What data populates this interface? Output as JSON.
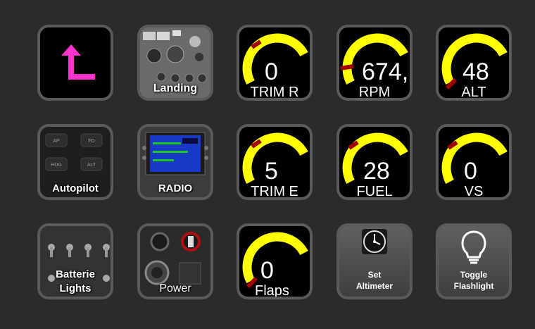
{
  "colors": {
    "background": "#2b2b2b",
    "gauge_arc": "#ffff00",
    "gauge_needle": "#a00000",
    "back_arrow": "#ff33cc"
  },
  "buttons": {
    "back": {
      "icon": "back-arrow-icon"
    },
    "landing": {
      "label": "Landing"
    },
    "autopilot": {
      "label": "Autopilot",
      "panel_labels": [
        "AP",
        "FD",
        "HDG",
        "ALT"
      ]
    },
    "radio": {
      "label": "RADIO"
    },
    "batteries": {
      "label_line1": "Batterie",
      "label_line2": "Lights"
    },
    "power": {
      "label": "Power"
    },
    "set_altimeter": {
      "label_line1": "Set",
      "label_line2": "Altimeter",
      "icon": "altimeter-icon"
    },
    "toggle_flashlight": {
      "label_line1": "Toggle",
      "label_line2": "Flashlight",
      "icon": "lightbulb-icon"
    }
  },
  "gauges": {
    "trim_r": {
      "value": "0",
      "label": "TRIM R"
    },
    "rpm": {
      "value": "674,",
      "label": "RPM"
    },
    "alt": {
      "value": "48",
      "label": "ALT"
    },
    "trim_e": {
      "value": "5",
      "label": "TRIM E"
    },
    "fuel": {
      "value": "28",
      "label": "FUEL"
    },
    "vs": {
      "value": "0",
      "label": "VS"
    },
    "flaps": {
      "value": "0",
      "label": "Flaps"
    }
  }
}
